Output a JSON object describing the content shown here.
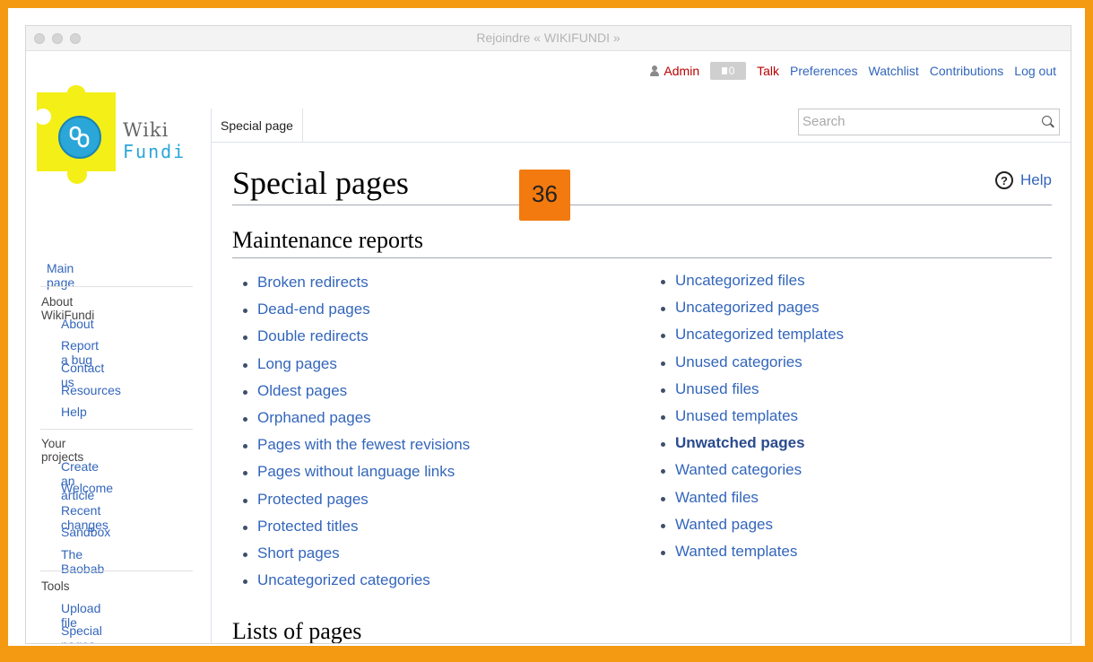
{
  "window": {
    "title": "Rejoindre « WIKIFUNDI »"
  },
  "personal_tools": {
    "user": "Admin",
    "notifications_count": "0",
    "talk": "Talk",
    "preferences": "Preferences",
    "watchlist": "Watchlist",
    "contributions": "Contributions",
    "logout": "Log out"
  },
  "logo": {
    "line1": "Wiki",
    "line2": "Fundi",
    "colors": {
      "yellow": "#f4ef16",
      "blue": "#2aa6d8"
    }
  },
  "tabs": {
    "active": "Special page"
  },
  "search": {
    "placeholder": "Search"
  },
  "sidebar": {
    "main_page": "Main page",
    "sections": [
      {
        "heading": "About WikiFundi",
        "items": [
          "About",
          "Report a bug",
          "Contact us",
          "Resources",
          "Help"
        ]
      },
      {
        "heading": "Your projects",
        "items": [
          "Create an article",
          "Welcome",
          "Recent changes",
          "Sandbox",
          "The Baobab"
        ]
      },
      {
        "heading": "Tools",
        "items": [
          "Upload file",
          "Special pages"
        ]
      }
    ]
  },
  "content": {
    "title": "Special pages",
    "help": "Help",
    "section1": "Maintenance reports",
    "section2": "Lists of pages",
    "left_links": [
      "Broken redirects",
      "Dead-end pages",
      "Double redirects",
      "Long pages",
      "Oldest pages",
      "Orphaned pages",
      "Pages with the fewest revisions",
      "Pages without language links",
      "Protected pages",
      "Protected titles",
      "Short pages",
      "Uncategorized categories"
    ],
    "right_links": [
      "Uncategorized files",
      "Uncategorized pages",
      "Uncategorized templates",
      "Unused categories",
      "Unused files",
      "Unused templates",
      "Unwatched pages",
      "Wanted categories",
      "Wanted files",
      "Wanted pages",
      "Wanted templates"
    ]
  },
  "step_badge": "36",
  "colors": {
    "frame": "#f39a12",
    "badge": "#f27a0f",
    "link": "#3366bb",
    "red_link": "#ba0000"
  }
}
